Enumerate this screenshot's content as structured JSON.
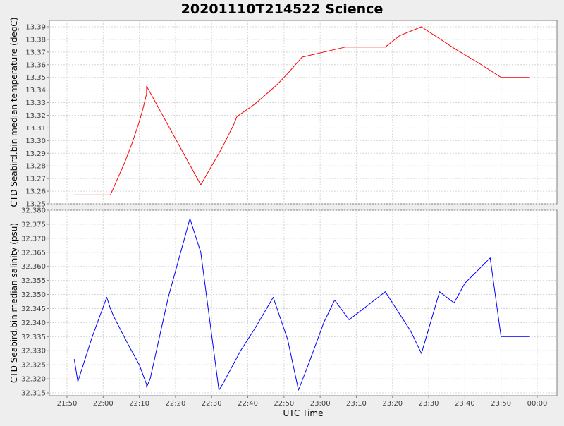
{
  "chart_data": {
    "type": "line",
    "title": "20201110T214522 Science",
    "xlabel": "UTC Time",
    "x_ticks": [
      "21:50",
      "22:00",
      "22:10",
      "22:20",
      "22:30",
      "22:40",
      "22:50",
      "23:00",
      "23:10",
      "23:20",
      "23:30",
      "23:40",
      "23:50",
      "00:00"
    ],
    "x_start": "21:50",
    "x_end": "00:00",
    "grid": true,
    "panels": [
      {
        "ylabel": "CTD Seabird.bin median temperature (degC)",
        "ylim": [
          13.25,
          13.395
        ],
        "y_ticks": [
          "13.25",
          "13.26",
          "13.27",
          "13.28",
          "13.29",
          "13.30",
          "13.31",
          "13.32",
          "13.33",
          "13.34",
          "13.35",
          "13.36",
          "13.37",
          "13.38",
          "13.39"
        ],
        "color": "#ff0000",
        "series": [
          {
            "x": [
              "21:52",
              "22:02",
              "22:06",
              "22:08",
              "22:10",
              "22:11",
              "22:12",
              "22:12",
              "22:13",
              "22:27",
              "22:31",
              "22:33",
              "22:36",
              "22:37",
              "22:42",
              "22:48",
              "22:51",
              "22:55",
              "23:07",
              "23:18",
              "23:22",
              "23:28",
              "23:37",
              "23:44",
              "23:50",
              "23:58"
            ],
            "y": [
              13.257,
              13.257,
              13.283,
              13.298,
              13.315,
              13.325,
              13.337,
              13.343,
              13.338,
              13.265,
              13.285,
              13.295,
              13.312,
              13.319,
              13.329,
              13.344,
              13.353,
              13.366,
              13.374,
              13.374,
              13.383,
              13.39,
              13.373,
              13.361,
              13.35,
              13.35
            ]
          }
        ]
      },
      {
        "ylabel": "CTD Seabird.bin median salinity (psu)",
        "ylim": [
          32.314,
          32.38
        ],
        "y_ticks": [
          "32.315",
          "32.320",
          "32.325",
          "32.330",
          "32.335",
          "32.340",
          "32.345",
          "32.350",
          "32.355",
          "32.360",
          "32.365",
          "32.370",
          "32.375",
          "32.380"
        ],
        "color": "#0000ff",
        "series": [
          {
            "x": [
              "21:52",
              "21:53",
              "21:57",
              "22:01",
              "22:02",
              "22:03",
              "22:07",
              "22:10",
              "22:12",
              "22:12",
              "22:13",
              "22:18",
              "22:24",
              "22:27",
              "22:32",
              "22:33",
              "22:38",
              "22:42",
              "22:47",
              "22:51",
              "22:54",
              "22:57",
              "23:01",
              "23:04",
              "23:08",
              "23:18",
              "23:25",
              "23:28",
              "23:33",
              "23:36",
              "23:37",
              "23:40",
              "23:47",
              "23:50",
              "23:58"
            ],
            "y": [
              32.327,
              32.319,
              32.335,
              32.349,
              32.345,
              32.342,
              32.332,
              32.325,
              32.318,
              32.317,
              32.32,
              32.349,
              32.377,
              32.365,
              32.316,
              32.318,
              32.33,
              32.338,
              32.349,
              32.334,
              32.316,
              32.326,
              32.34,
              32.348,
              32.341,
              32.351,
              32.337,
              32.329,
              32.351,
              32.348,
              32.347,
              32.354,
              32.363,
              32.335,
              32.335
            ]
          }
        ]
      }
    ]
  }
}
